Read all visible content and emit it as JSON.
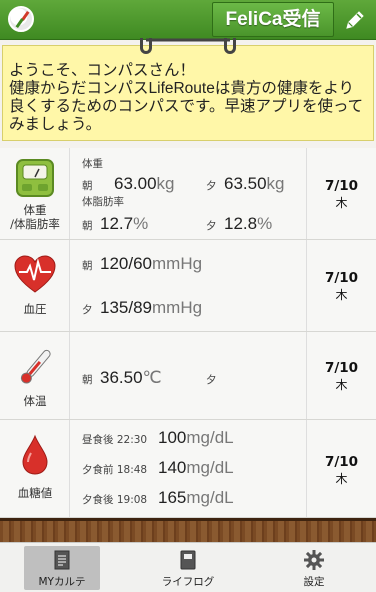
{
  "header": {
    "felica_label": "FeliCa受信"
  },
  "welcome": {
    "line1": "ようこそ、コンパスさん！",
    "line2": "健康からだコンパスLifeRouteは貴方の健康をより良くするためのコンパスです。早速アプリを使ってみましょう。"
  },
  "records": {
    "weight": {
      "label_line1": "体重",
      "label_line2": "/体脂肪率",
      "weight_title": "体重",
      "fat_title": "体脂肪率",
      "morning": "朝",
      "evening": "夕",
      "w_am": "63.00",
      "w_pm": "63.50",
      "w_unit": "kg",
      "f_am": "12.7",
      "f_pm": "12.8",
      "f_unit": "%",
      "date": "7/10",
      "weekday": "木"
    },
    "bp": {
      "label": "血圧",
      "morning": "朝",
      "evening": "夕",
      "am": "120/60",
      "pm": "135/89",
      "unit": "mmHg",
      "date": "7/10",
      "weekday": "木"
    },
    "temp": {
      "label": "体温",
      "morning": "朝",
      "evening": "夕",
      "am": "36.50",
      "unit": "℃",
      "date": "7/10",
      "weekday": "木"
    },
    "glucose": {
      "label": "血糖値",
      "t1": "昼食後 22:30",
      "v1": "100",
      "t2": "夕食前 18:48",
      "v2": "140",
      "t3": "夕食後 19:08",
      "v3": "165",
      "unit": "mg/dL",
      "date": "7/10",
      "weekday": "木"
    }
  },
  "nav": {
    "karte": "MYカルテ",
    "lifelog": "ライフログ",
    "settings": "設定"
  }
}
